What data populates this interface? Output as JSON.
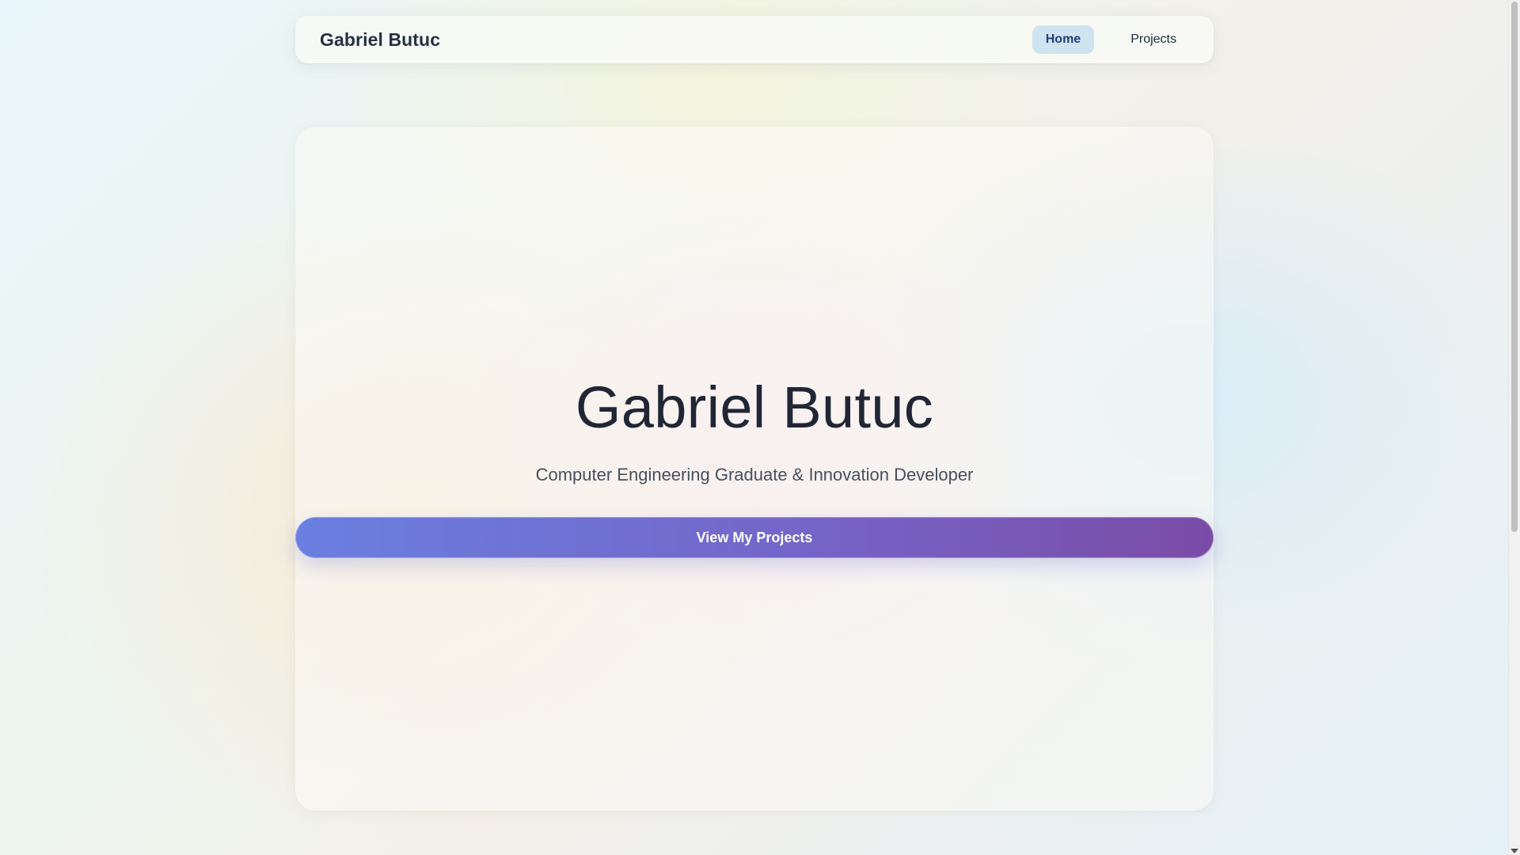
{
  "navbar": {
    "brand": "Gabriel Butuc",
    "links": [
      {
        "label": "Home",
        "active": true
      },
      {
        "label": "Projects",
        "active": false
      }
    ]
  },
  "hero": {
    "title": "Gabriel Butuc",
    "subtitle": "Computer Engineering Graduate & Innovation Developer",
    "cta_label": "View My Projects"
  },
  "colors": {
    "accent_gradient_start": "#6a7fe0",
    "accent_gradient_end": "#7a4ca6",
    "active_nav_bg": "#cde2f0",
    "text_dark": "#202634"
  }
}
